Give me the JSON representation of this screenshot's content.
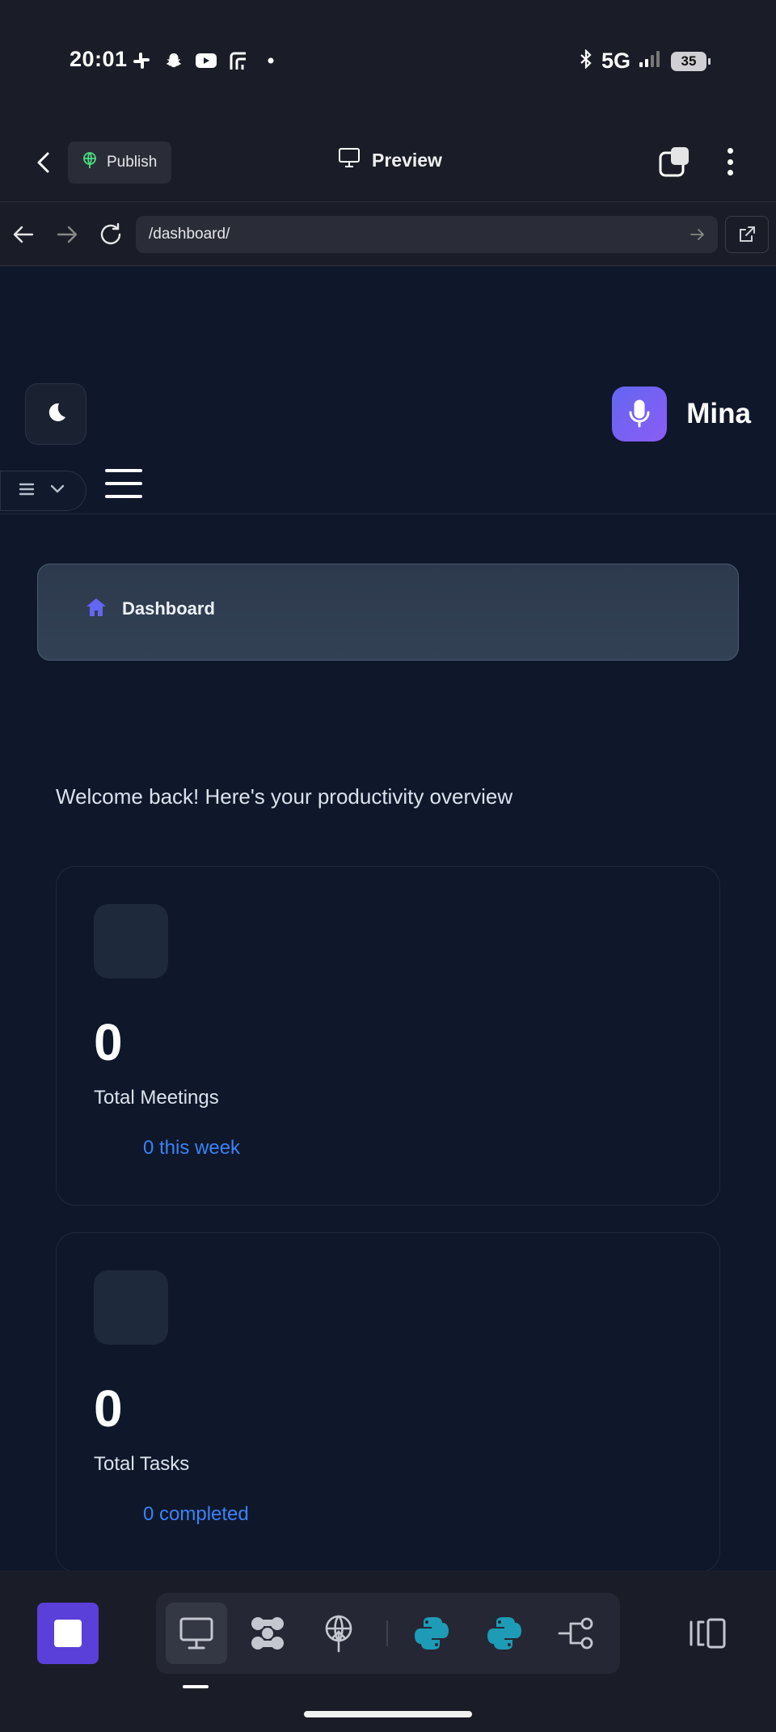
{
  "status_bar": {
    "time": "20:01",
    "network": "5G",
    "battery": "35",
    "left_icons": [
      "slack-icon",
      "snapchat-icon",
      "youtube-icon",
      "app-icon",
      "dot-icon"
    ],
    "right_icons": [
      "bluetooth-icon",
      "signal-icon",
      "battery-icon"
    ]
  },
  "topbar": {
    "publish_label": "Publish",
    "preview_label": "Preview"
  },
  "urlbar": {
    "url": "/dashboard/"
  },
  "app": {
    "brand_name": "Mina",
    "breadcrumb": "Dashboard",
    "welcome": "Welcome back! Here's your productivity overview",
    "stats": [
      {
        "value": "0",
        "label": "Total Meetings",
        "sub": "0 this week"
      },
      {
        "value": "0",
        "label": "Total Tasks",
        "sub": "0 completed"
      }
    ]
  },
  "colors": {
    "app_bg": "#0f172a",
    "chrome_bg": "#1a1d27",
    "accent": "#6366f1",
    "link": "#3b82f6",
    "stop_button": "#5b3fd9",
    "python_icon": "#1e9bb6"
  },
  "toolbar": {
    "tools": [
      "monitor-icon",
      "pinwheel-icon",
      "deploy-icon",
      "python-icon",
      "python-icon",
      "flow-icon"
    ],
    "active_tool": "monitor-icon"
  }
}
